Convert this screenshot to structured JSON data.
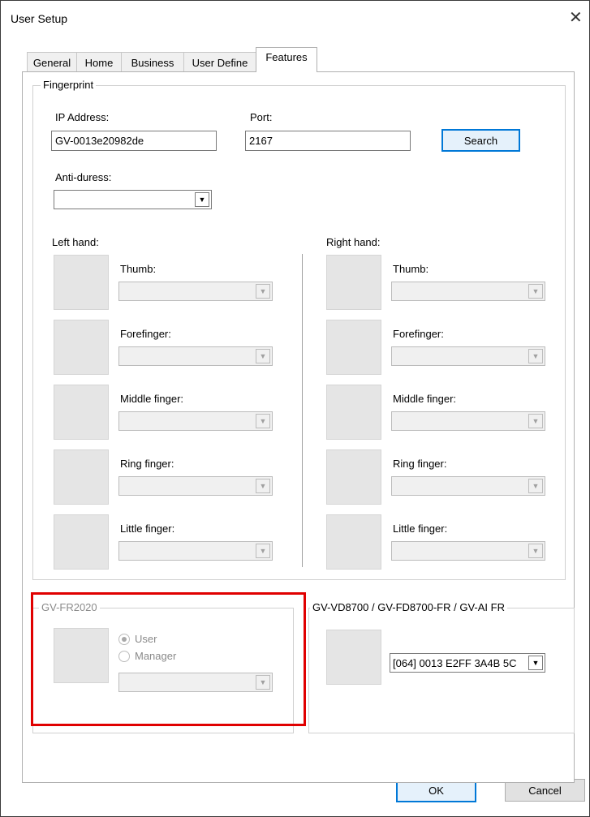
{
  "window": {
    "title": "User Setup",
    "close_glyph": "✕"
  },
  "tabs": [
    "General",
    "Home",
    "Business",
    "User Define",
    "Features"
  ],
  "fingerprint": {
    "group_label": "Fingerprint",
    "ip_label": "IP Address:",
    "ip_value": "GV-0013e20982de",
    "port_label": "Port:",
    "port_value": "2167",
    "search_label": "Search",
    "anti_duress_label": "Anti-duress:",
    "anti_duress_value": "",
    "left_hand_label": "Left hand:",
    "right_hand_label": "Right hand:",
    "fingers": [
      "Thumb:",
      "Forefinger:",
      "Middle finger:",
      "Ring finger:",
      "Little finger:"
    ]
  },
  "gvfr2020": {
    "group_label": "GV-FR2020",
    "user_label": "User",
    "manager_label": "Manager",
    "user_checked": true
  },
  "gvvd8700": {
    "group_label": "GV-VD8700 / GV-FD8700-FR / GV-AI FR",
    "device_value": "[064] 0013 E2FF 3A4B 5C"
  },
  "footer": {
    "ok_label": "OK",
    "cancel_label": "Cancel"
  },
  "icons": {
    "dropdown": "chevron-down-icon",
    "close": "close-icon"
  },
  "colors": {
    "highlight": "#e00000",
    "focus_border": "#0078d7"
  }
}
